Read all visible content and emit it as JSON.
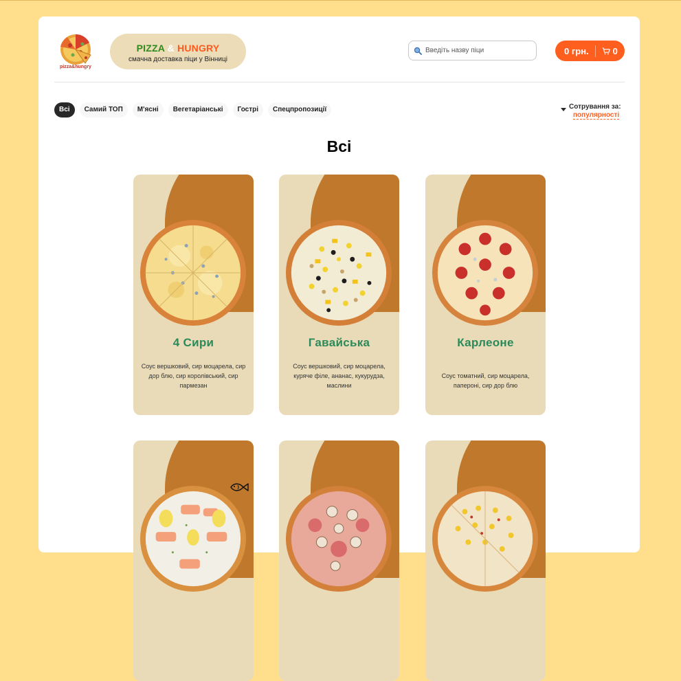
{
  "header": {
    "logo_text": "pizza&hungry",
    "brand_word1": "PIZZA",
    "brand_amp": "&",
    "brand_word2": "HUNGRY",
    "brand_subtitle": "смачна доставка піци у Вінниці",
    "search_placeholder": "Введіть назву піци",
    "cart_price": "0 грн.",
    "cart_count": "0"
  },
  "categories": [
    {
      "label": "Всі",
      "active": true
    },
    {
      "label": "Самий ТОП",
      "active": false
    },
    {
      "label": "М'ясні",
      "active": false
    },
    {
      "label": "Вегетаріанські",
      "active": false
    },
    {
      "label": "Гострі",
      "active": false
    },
    {
      "label": "Спецпропозиції",
      "active": false
    }
  ],
  "sort": {
    "label": "Сотрування за:",
    "value": "популярності"
  },
  "section_title": "Всі",
  "pizzas": [
    {
      "name": "4 Сири",
      "description": "Соус вершковий, сир моцарела, сир дор блю, сир королівський, сир пармезан",
      "style": "cheese"
    },
    {
      "name": "Гавайська",
      "description": "Соус вершковий, сир моцарела, куряче філе, ананас, кукурудза, маслини",
      "style": "hawaii"
    },
    {
      "name": "Карлеоне",
      "description": "Соус томатний, сир моцарела, папероні, сир дор блю",
      "style": "pepperoni"
    },
    {
      "name": "",
      "description": "",
      "style": "salmon",
      "badge": "fish-icon"
    },
    {
      "name": "",
      "description": "",
      "style": "mushroom"
    },
    {
      "name": "",
      "description": "",
      "style": "corn"
    }
  ],
  "colors": {
    "page_bg": "#ffdf8c",
    "accent": "#fe5f1e",
    "card_bg": "#e9dbb8",
    "card_blob": "#bf782c",
    "pizza_name": "#2b8a5a"
  }
}
